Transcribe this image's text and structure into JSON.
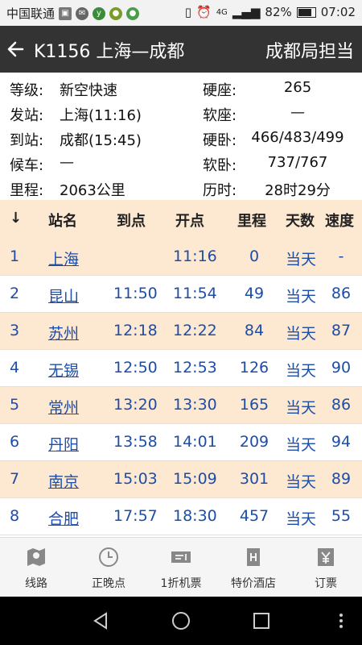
{
  "status_bar": {
    "carrier": "中国联通",
    "battery": "82%",
    "time": "07:02",
    "network": "4G"
  },
  "header": {
    "title": "K1156 上海—成都",
    "bureau": "成都局担当"
  },
  "info": [
    {
      "k1": "等级:",
      "v1": "新空快速",
      "k2": "硬座:",
      "v2": "265"
    },
    {
      "k1": "发站:",
      "v1": "上海(11:16)",
      "k2": "软座:",
      "v2": "—"
    },
    {
      "k1": "到站:",
      "v1": "成都(15:45)",
      "k2": "硬卧:",
      "v2": "466/483/499"
    },
    {
      "k1": "候车:",
      "v1": "—",
      "k2": "软卧:",
      "v2": "737/767"
    },
    {
      "k1": "里程:",
      "v1": "2063公里",
      "k2": "历时:",
      "v2": "28时29分"
    }
  ],
  "table": {
    "headers": {
      "idx": "↓",
      "name": "站名",
      "arrive": "到点",
      "depart": "开点",
      "km": "里程",
      "day": "天数",
      "speed": "速度"
    },
    "rows": [
      {
        "idx": "1",
        "name": "上海",
        "arrive": "",
        "depart": "11:16",
        "km": "0",
        "day": "当天",
        "speed": "-"
      },
      {
        "idx": "2",
        "name": "昆山",
        "arrive": "11:50",
        "depart": "11:54",
        "km": "49",
        "day": "当天",
        "speed": "86"
      },
      {
        "idx": "3",
        "name": "苏州",
        "arrive": "12:18",
        "depart": "12:22",
        "km": "84",
        "day": "当天",
        "speed": "87"
      },
      {
        "idx": "4",
        "name": "无锡",
        "arrive": "12:50",
        "depart": "12:53",
        "km": "126",
        "day": "当天",
        "speed": "90"
      },
      {
        "idx": "5",
        "name": "常州",
        "arrive": "13:20",
        "depart": "13:30",
        "km": "165",
        "day": "当天",
        "speed": "86"
      },
      {
        "idx": "6",
        "name": "丹阳",
        "arrive": "13:58",
        "depart": "14:01",
        "km": "209",
        "day": "当天",
        "speed": "94"
      },
      {
        "idx": "7",
        "name": "南京",
        "arrive": "15:03",
        "depart": "15:09",
        "km": "301",
        "day": "当天",
        "speed": "89"
      },
      {
        "idx": "8",
        "name": "合肥",
        "arrive": "17:57",
        "depart": "18:30",
        "km": "457",
        "day": "当天",
        "speed": "55"
      }
    ]
  },
  "tabs": [
    {
      "label": "线路",
      "icon": "route-map-icon"
    },
    {
      "label": "正晚点",
      "icon": "clock-icon"
    },
    {
      "label": "1折机票",
      "icon": "ticket-plane-icon"
    },
    {
      "label": "特价酒店",
      "icon": "hotel-icon"
    },
    {
      "label": "订票",
      "icon": "yen-ticket-icon"
    }
  ],
  "colors": {
    "header_bg": "#333333",
    "row_even": "#fde8d2",
    "row_odd": "#ffffff",
    "link_blue": "#1c4da8"
  }
}
